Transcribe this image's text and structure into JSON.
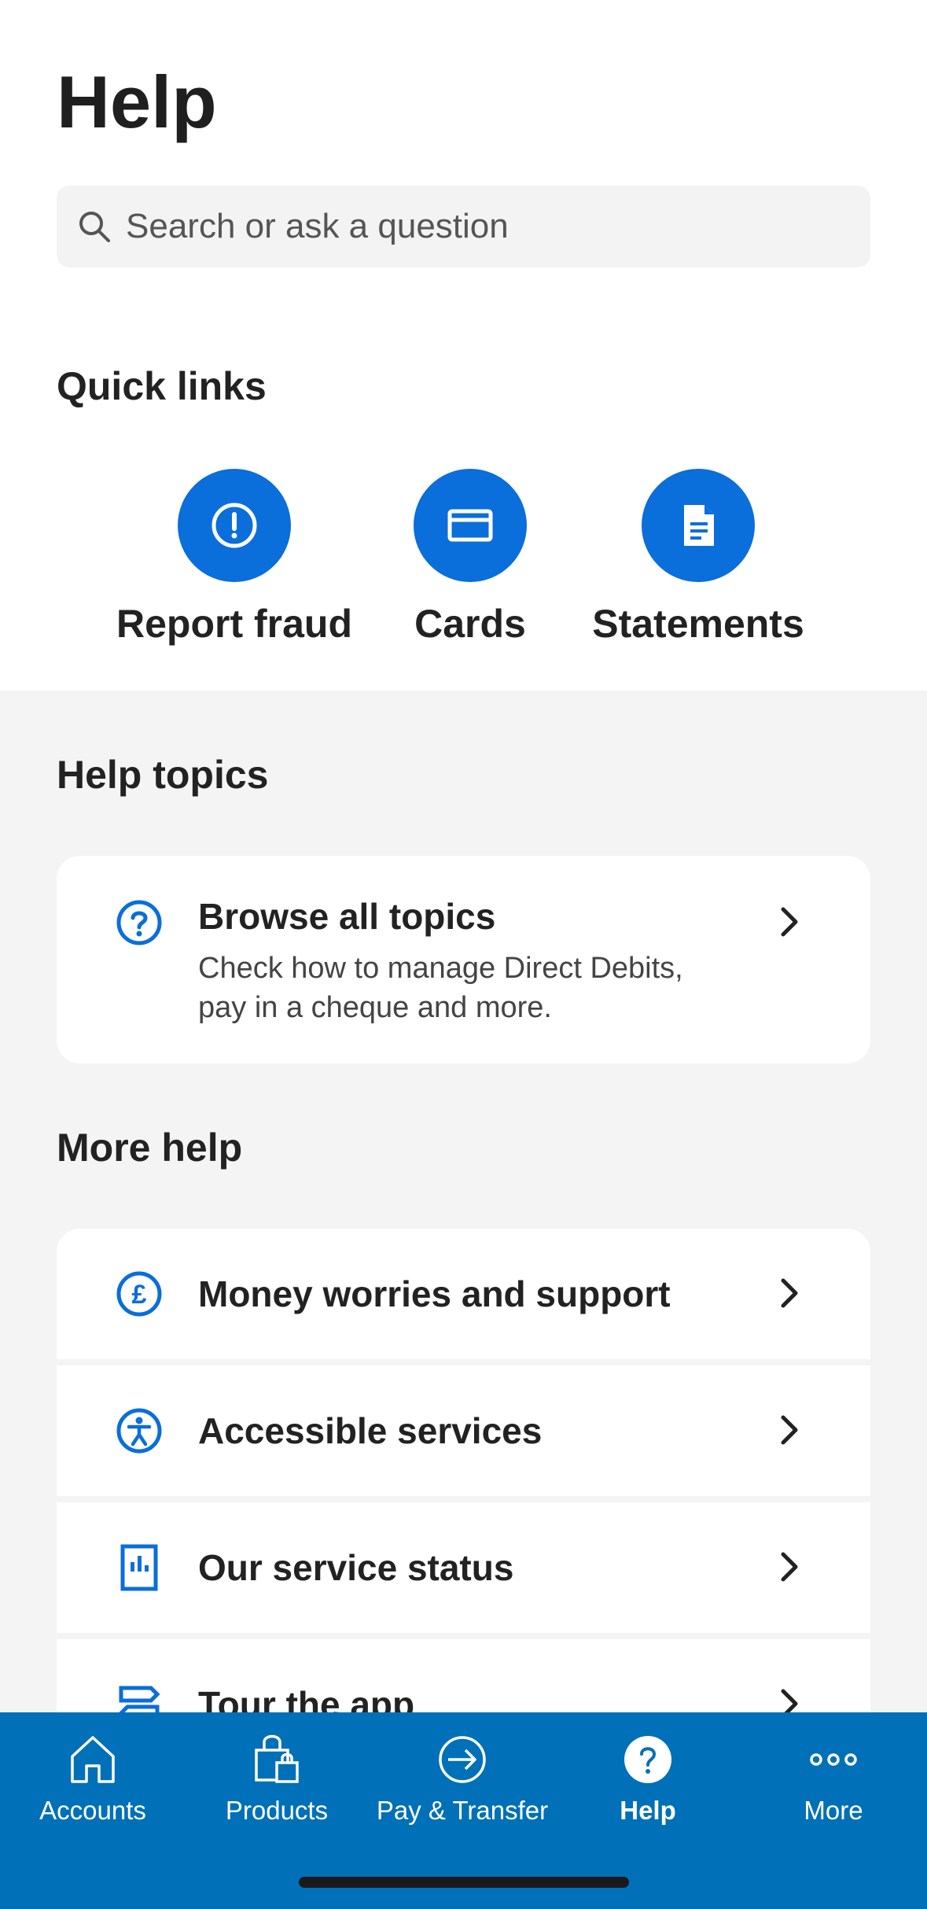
{
  "page": {
    "title": "Help"
  },
  "search": {
    "placeholder": "Search or ask a question"
  },
  "quick_links": {
    "heading": "Quick links",
    "items": [
      {
        "label": "Report fraud",
        "icon": "exclamation-icon"
      },
      {
        "label": "Cards",
        "icon": "card-icon"
      },
      {
        "label": "Statements",
        "icon": "document-icon"
      }
    ]
  },
  "help_topics": {
    "heading": "Help topics",
    "browse": {
      "title": "Browse all topics",
      "subtitle": "Check how to manage Direct Debits, pay in a cheque and more.",
      "icon": "question-circle-icon"
    }
  },
  "more_help": {
    "heading": "More help",
    "items": [
      {
        "label": "Money worries and support",
        "icon": "pound-circle-icon"
      },
      {
        "label": "Accessible services",
        "icon": "accessibility-icon"
      },
      {
        "label": "Our service status",
        "icon": "service-status-icon"
      },
      {
        "label": "Tour the app",
        "icon": "signpost-icon"
      }
    ]
  },
  "bottom_nav": {
    "items": [
      {
        "label": "Accounts",
        "icon": "home-icon",
        "active": false
      },
      {
        "label": "Products",
        "icon": "shopping-bag-icon",
        "active": false
      },
      {
        "label": "Pay & Transfer",
        "icon": "arrow-circle-icon",
        "active": false
      },
      {
        "label": "Help",
        "icon": "help-icon",
        "active": true
      },
      {
        "label": "More",
        "icon": "more-dots-icon",
        "active": false
      }
    ]
  },
  "colors": {
    "accent": "#0a6edb",
    "nav_bg": "#0070b8",
    "section_bg": "#f4f4f4"
  }
}
